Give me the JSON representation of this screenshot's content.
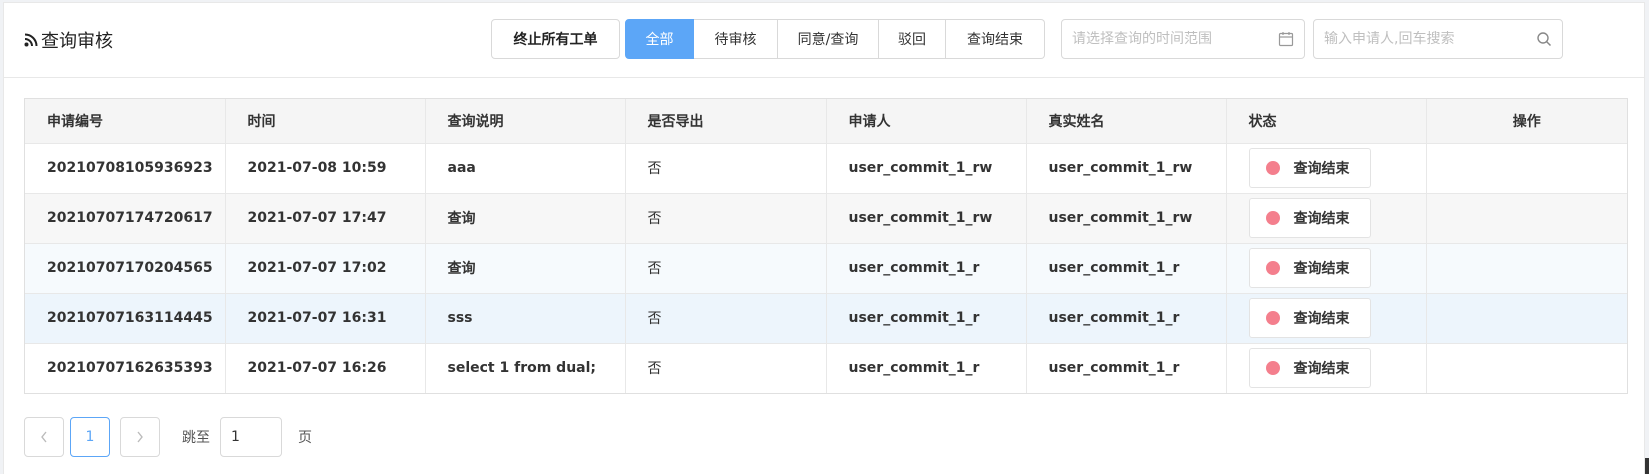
{
  "header": {
    "title": "查询审核",
    "stop_all_label": "终止所有工单",
    "filters": [
      {
        "label": "全部",
        "active": true
      },
      {
        "label": "待审核",
        "active": false
      },
      {
        "label": "同意/查询",
        "active": false
      },
      {
        "label": "驳回",
        "active": false
      },
      {
        "label": "查询结束",
        "active": false
      }
    ],
    "date_placeholder": "请选择查询的时间范围",
    "search_placeholder": "输入申请人,回车搜索"
  },
  "table": {
    "columns": [
      "申请编号",
      "时间",
      "查询说明",
      "是否导出",
      "申请人",
      "真实姓名",
      "状态",
      "操作"
    ],
    "rows": [
      {
        "id": "20210708105936923",
        "time": "2021-07-08 10:59",
        "desc": "aaa",
        "export": "否",
        "applicant": "user_commit_1_rw",
        "real_name": "user_commit_1_rw",
        "status": "查询结束",
        "action": ""
      },
      {
        "id": "20210707174720617",
        "time": "2021-07-07 17:47",
        "desc": "查询",
        "export": "否",
        "applicant": "user_commit_1_rw",
        "real_name": "user_commit_1_rw",
        "status": "查询结束",
        "action": ""
      },
      {
        "id": "20210707170204565",
        "time": "2021-07-07 17:02",
        "desc": "查询",
        "export": "否",
        "applicant": "user_commit_1_r",
        "real_name": "user_commit_1_r",
        "status": "查询结束",
        "action": ""
      },
      {
        "id": "20210707163114445",
        "time": "2021-07-07 16:31",
        "desc": "sss",
        "export": "否",
        "applicant": "user_commit_1_r",
        "real_name": "user_commit_1_r",
        "status": "查询结束",
        "action": ""
      },
      {
        "id": "20210707162635393",
        "time": "2021-07-07 16:26",
        "desc": "select 1 from dual;",
        "export": "否",
        "applicant": "user_commit_1_r",
        "real_name": "user_commit_1_r",
        "status": "查询结束",
        "action": ""
      }
    ]
  },
  "pagination": {
    "current_page": "1",
    "jump_label": "跳至",
    "jump_value": "1",
    "page_unit": "页",
    "prev_icon": "chevron-left-icon",
    "next_icon": "chevron-right-icon"
  },
  "colors": {
    "accent": "#5ca6f7",
    "status_dot": "#f47f8d"
  }
}
